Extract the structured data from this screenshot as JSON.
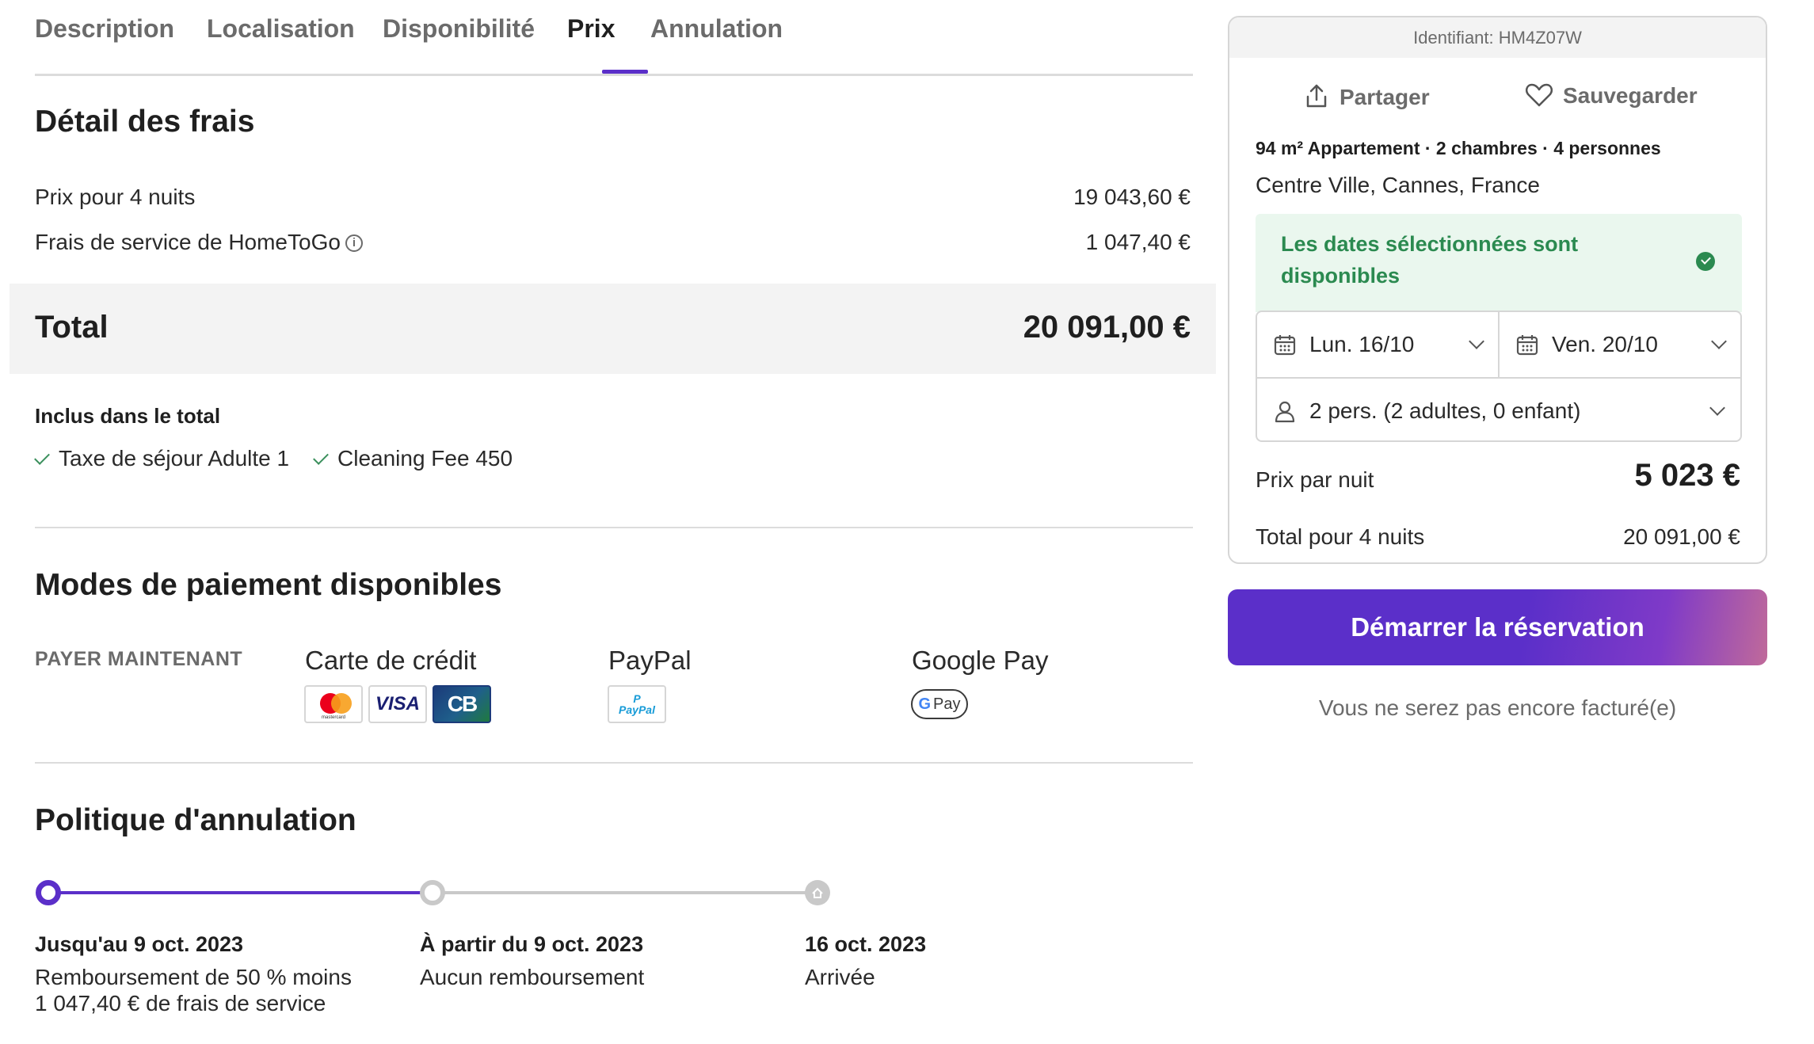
{
  "tabs": {
    "description": "Description",
    "location": "Localisation",
    "availability": "Disponibilité",
    "price": "Prix",
    "cancellation": "Annulation",
    "active": "Prix"
  },
  "fees": {
    "title": "Détail des frais",
    "rows": [
      {
        "label": "Prix pour 4 nuits",
        "value": "19 043,60 €"
      },
      {
        "label": "Frais de service de HomeToGo",
        "value": "1 047,40 €"
      }
    ],
    "total_label": "Total",
    "total_value": "20 091,00 €",
    "included_title": "Inclus dans le total",
    "included_items": [
      "Taxe de séjour Adulte 1",
      "Cleaning Fee 450"
    ]
  },
  "payment": {
    "title": "Modes de paiement disponibles",
    "pay_now": "PAYER MAINTENANT",
    "methods": [
      {
        "name": "Carte de crédit",
        "logos": [
          "mastercard",
          "VISA",
          "CB"
        ]
      },
      {
        "name": "PayPal",
        "logos": [
          "PayPal"
        ]
      },
      {
        "name": "Google Pay",
        "logos": [
          "G Pay"
        ]
      }
    ],
    "mastercard_text": "mastercard",
    "visa_text": "VISA",
    "cb_text": "CB",
    "paypal_text": "PayPal",
    "gpay_g": "G",
    "gpay_text": "Pay"
  },
  "cancellation": {
    "title": "Politique d'annulation",
    "steps": [
      {
        "title": "Jusqu'au 9 oct. 2023",
        "desc_line1": "Remboursement de 50 % moins",
        "desc_line2": "1 047,40 € de frais de service"
      },
      {
        "title": "À partir du 9 oct. 2023",
        "desc_line1": "Aucun remboursement"
      },
      {
        "title": "16 oct. 2023",
        "desc_line1": "Arrivée"
      }
    ],
    "accent_color": "#5b2fc9"
  },
  "booking": {
    "identifier": "Identifiant: HM4Z07W",
    "share_label": "Partager",
    "save_label": "Sauvegarder",
    "property_meta": "94 m² Appartement · 2 chambres · 4 personnes",
    "location": "Centre Ville, Cannes, France",
    "availability_text": "Les dates sélectionnées sont disponibles",
    "checkin": "Lun. 16/10",
    "checkout": "Ven. 20/10",
    "guests": "2 pers. (2 adultes, 0 enfant)",
    "price_per_night_label": "Prix par nuit",
    "price_per_night_value": "5 023 €",
    "total_label": "Total pour 4 nuits",
    "total_value": "20 091,00 €",
    "cta_label": "Démarrer la réservation",
    "cta_note": "Vous ne serez pas encore facturé(e)",
    "brand_color": "#5b2fc9",
    "available_color": "#2b8a50"
  }
}
